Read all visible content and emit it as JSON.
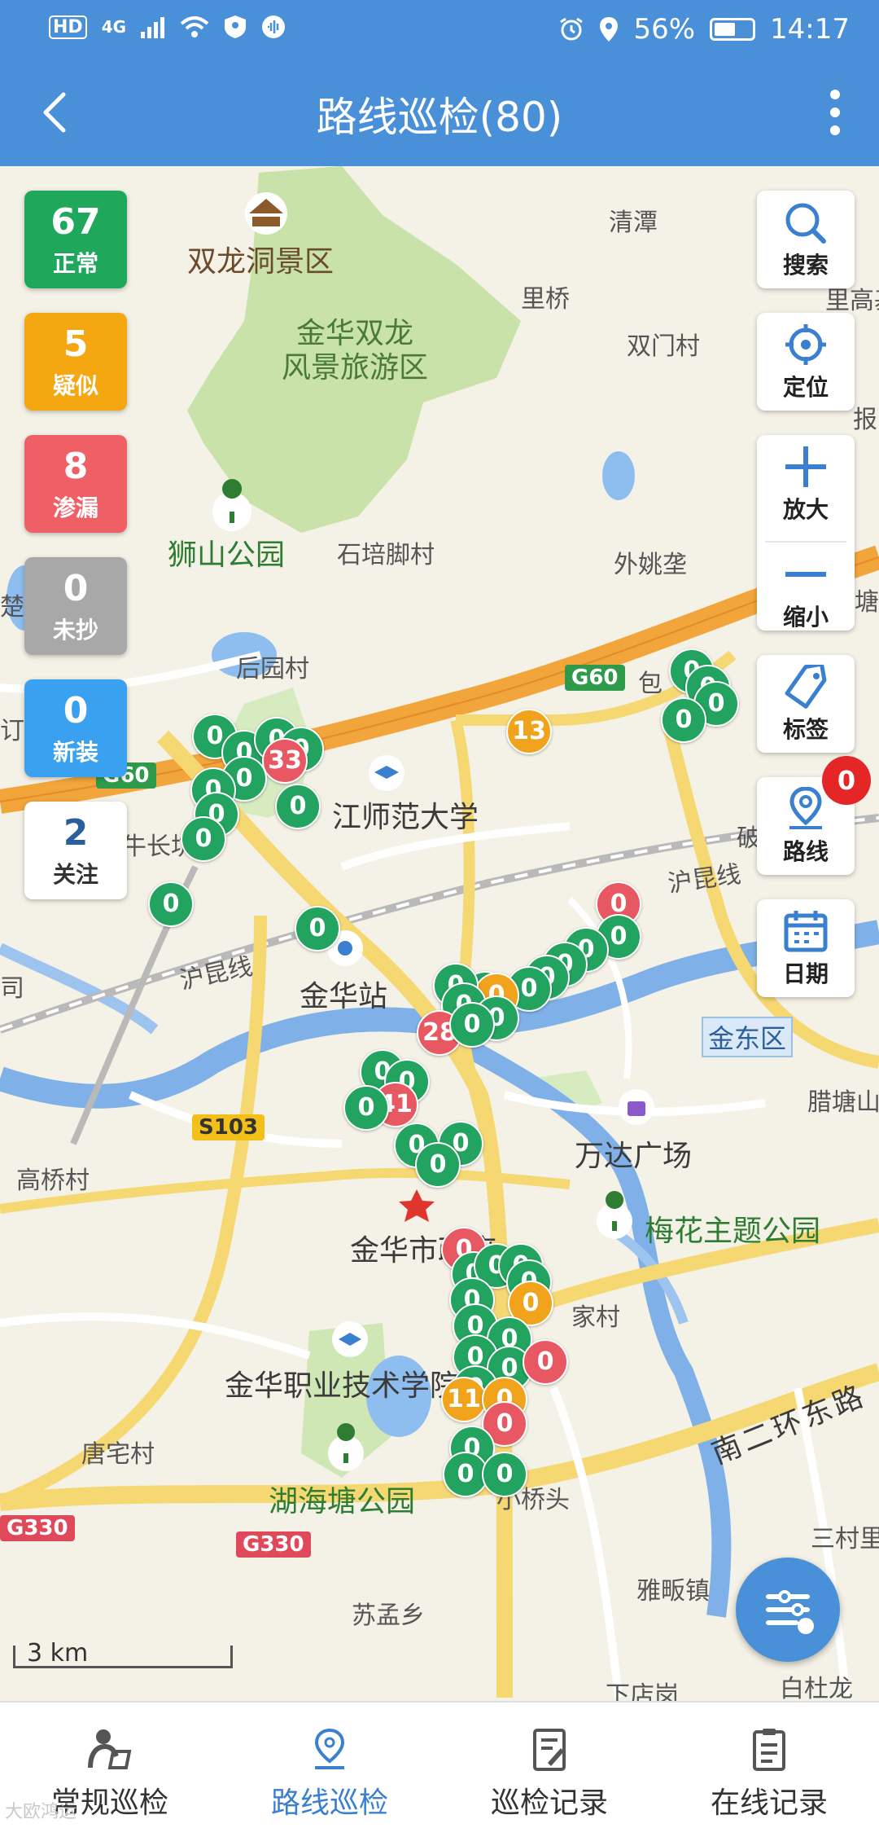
{
  "status_bar": {
    "hd": "HD",
    "network": "4G",
    "battery": "56%",
    "battery_level": 0.56,
    "time": "14:17"
  },
  "app_bar": {
    "title": "路线巡检(80)"
  },
  "stats": [
    {
      "count": "67",
      "label": "正常",
      "color": "#1fa85c"
    },
    {
      "count": "5",
      "label": "疑似",
      "color": "#f4a711"
    },
    {
      "count": "8",
      "label": "渗漏",
      "color": "#ee5f66"
    },
    {
      "count": "0",
      "label": "未抄",
      "color": "#a8a8a8"
    },
    {
      "count": "0",
      "label": "新装",
      "color": "#3aa0f0"
    },
    {
      "count": "2",
      "label": "关注",
      "color": "#ffffff"
    }
  ],
  "tools": {
    "search": "搜索",
    "locate": "定位",
    "zoom_in": "放大",
    "zoom_out": "缩小",
    "tag": "标签",
    "route": "路线",
    "route_badge": "0",
    "date": "日期"
  },
  "map": {
    "labels": {
      "shuanglong_area": "双龙洞景区",
      "scenic_area": "金华双龙\n风景旅游区",
      "qingyuan": "清潭",
      "liqiao": "里桥",
      "ligaoji": "里高基",
      "shuangmen": "双门村",
      "bao": "报",
      "shishan_park": "狮山公园",
      "shipei": "石培脚村",
      "waiyao": "外姚垄",
      "houyuan": "后园村",
      "bao2": "包",
      "tang": "塘",
      "chu": "楚",
      "ding": "订",
      "zhejiang_normal": "江师范大学",
      "niuchang": "牛长坑",
      "po": "破",
      "hukun": "沪昆线",
      "hukun2": "沪昆线",
      "jinhua_station": "金华站",
      "si": "司",
      "jindong": "金东区",
      "latang": "腊塘山",
      "wanda": "万达广场",
      "gaoqiao": "高桥村",
      "city_gov": "金华市政府",
      "plum_park": "梅花主题公园",
      "jiacun": "家村",
      "vocational": "金华职业技术学院",
      "tangzhai": "唐宅村",
      "huhaitang": "湖海塘公园",
      "xiaoqiaotou": "小桥头",
      "nan_ring": "南二环东路",
      "sancun": "三村里",
      "suzeng": "苏孟乡",
      "yafan": "雅畈镇",
      "xiadian": "下店岗",
      "baidulong": "白杜龙"
    },
    "shields": {
      "g60_a": "G60",
      "g60_b": "G60",
      "s103": "S103",
      "g330_a": "G330",
      "g330_b": "G330"
    },
    "scale": "3 km",
    "markers": [
      {
        "c": "green",
        "n": "0"
      },
      {
        "c": "green",
        "n": "0"
      },
      {
        "c": "green",
        "n": "0"
      },
      {
        "c": "green",
        "n": "0"
      },
      {
        "c": "orange",
        "n": "13"
      },
      {
        "c": "green",
        "n": "0"
      },
      {
        "c": "green",
        "n": "0"
      },
      {
        "c": "green",
        "n": "0"
      },
      {
        "c": "green",
        "n": "0"
      },
      {
        "c": "red",
        "n": "33"
      },
      {
        "c": "green",
        "n": "0"
      },
      {
        "c": "green",
        "n": "0"
      },
      {
        "c": "green",
        "n": "0"
      },
      {
        "c": "green",
        "n": "0"
      },
      {
        "c": "green",
        "n": "0"
      },
      {
        "c": "green",
        "n": "0"
      },
      {
        "c": "green",
        "n": "0"
      },
      {
        "c": "red",
        "n": "0"
      },
      {
        "c": "green",
        "n": "0"
      },
      {
        "c": "green",
        "n": "0"
      },
      {
        "c": "green",
        "n": "0"
      },
      {
        "c": "green",
        "n": "0"
      },
      {
        "c": "green",
        "n": "0"
      },
      {
        "c": "green",
        "n": "0"
      },
      {
        "c": "orange",
        "n": "0"
      },
      {
        "c": "green",
        "n": "0"
      },
      {
        "c": "green",
        "n": "0"
      },
      {
        "c": "green",
        "n": "0"
      },
      {
        "c": "red",
        "n": "28"
      },
      {
        "c": "green",
        "n": "0"
      },
      {
        "c": "green",
        "n": "0"
      },
      {
        "c": "green",
        "n": "0"
      },
      {
        "c": "red",
        "n": "41"
      },
      {
        "c": "green",
        "n": "0"
      },
      {
        "c": "green",
        "n": "0"
      },
      {
        "c": "green",
        "n": "0"
      },
      {
        "c": "green",
        "n": "0"
      },
      {
        "c": "red",
        "n": "0"
      },
      {
        "c": "green",
        "n": "0"
      },
      {
        "c": "green",
        "n": "0"
      },
      {
        "c": "green",
        "n": "0"
      },
      {
        "c": "green",
        "n": "0"
      },
      {
        "c": "green",
        "n": "0"
      },
      {
        "c": "orange",
        "n": "0"
      },
      {
        "c": "green",
        "n": "0"
      },
      {
        "c": "green",
        "n": "0"
      },
      {
        "c": "green",
        "n": "0"
      },
      {
        "c": "green",
        "n": "0"
      },
      {
        "c": "red",
        "n": "0"
      },
      {
        "c": "green",
        "n": "0"
      },
      {
        "c": "orange",
        "n": "11"
      },
      {
        "c": "orange",
        "n": "0"
      },
      {
        "c": "red",
        "n": "0"
      },
      {
        "c": "green",
        "n": "0"
      },
      {
        "c": "green",
        "n": "0"
      },
      {
        "c": "green",
        "n": "0"
      }
    ]
  },
  "tabs": [
    {
      "label": "常规巡检",
      "icon": "person-inspect-icon"
    },
    {
      "label": "路线巡检",
      "icon": "location-pin-icon"
    },
    {
      "label": "巡检记录",
      "icon": "edit-record-icon"
    },
    {
      "label": "在线记录",
      "icon": "clipboard-icon"
    }
  ],
  "watermark": "大欧鸿运"
}
